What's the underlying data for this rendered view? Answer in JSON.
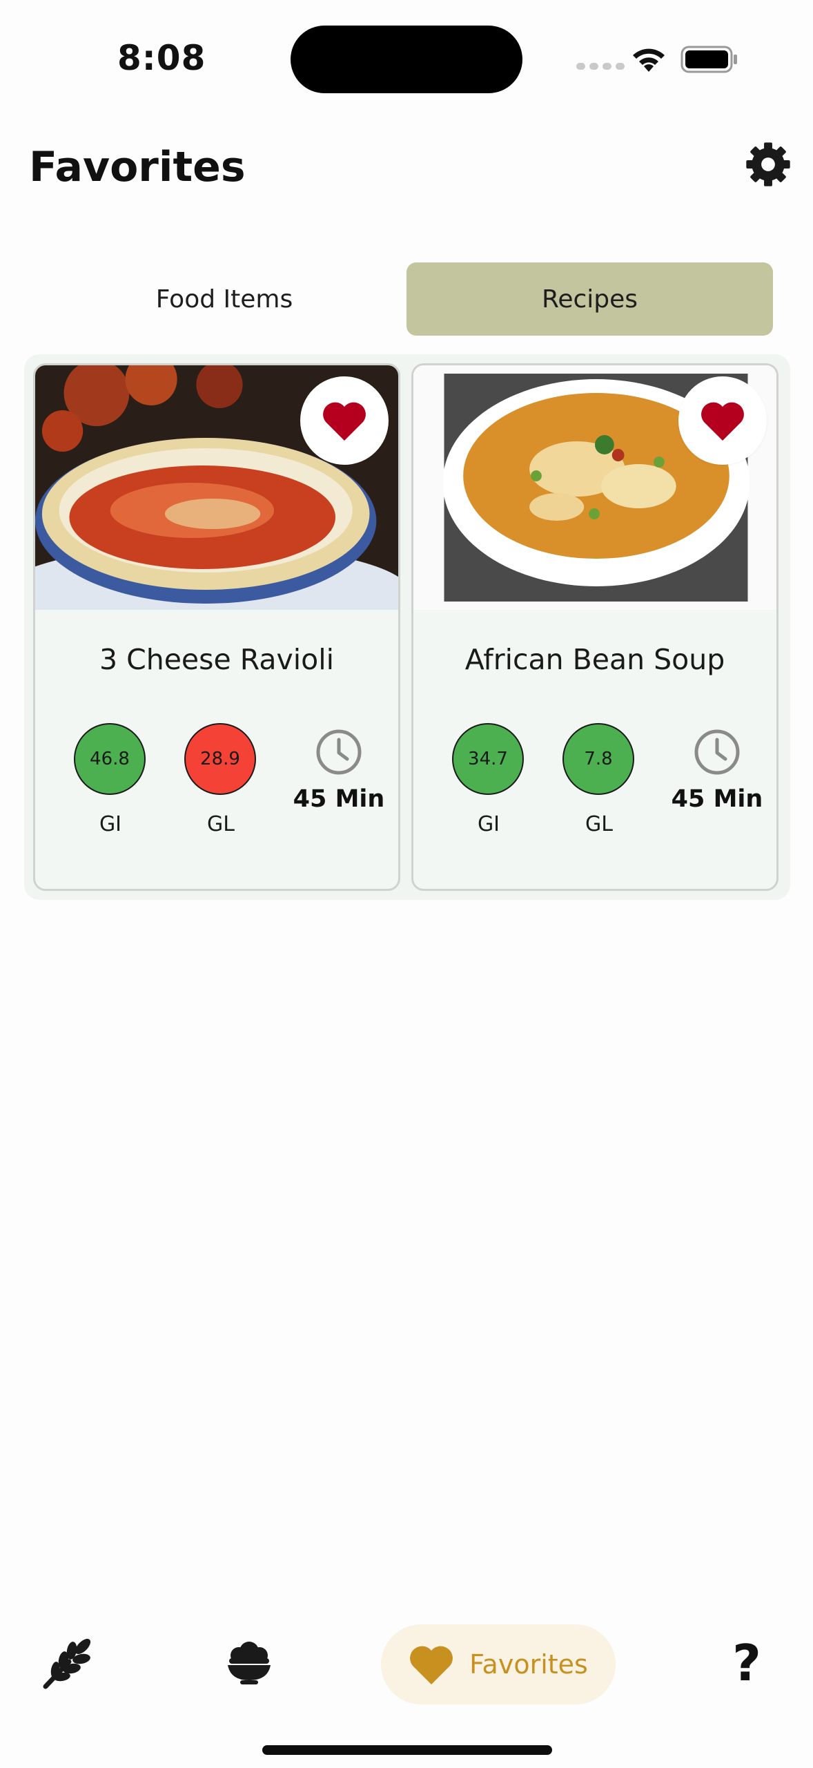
{
  "status_bar": {
    "time": "8:08"
  },
  "header": {
    "title": "Favorites",
    "settings_icon": "gear-icon"
  },
  "tabs": [
    {
      "label": "Food Items",
      "active": false
    },
    {
      "label": "Recipes",
      "active": true
    }
  ],
  "recipes": [
    {
      "name": "3 Cheese Ravioli",
      "gi": "46.8",
      "gi_color": "#4caf50",
      "gl": "28.9",
      "gl_color": "#f44336",
      "gi_label": "GI",
      "gl_label": "GL",
      "time": "45 Min",
      "favorite_icon": "heart-icon"
    },
    {
      "name": "African Bean Soup",
      "gi": "34.7",
      "gi_color": "#4caf50",
      "gl": "7.8",
      "gl_color": "#4caf50",
      "gi_label": "GI",
      "gl_label": "GL",
      "time": "45 Min",
      "favorite_icon": "heart-icon"
    }
  ],
  "bottom_nav": {
    "items": [
      {
        "icon": "wheat-icon"
      },
      {
        "icon": "bowl-icon"
      },
      {
        "icon": "heart-icon",
        "label": "Favorites",
        "active": true
      },
      {
        "icon": "question-icon",
        "label": "?"
      }
    ]
  },
  "colors": {
    "accent": "#c8901f",
    "tab_active": "#c2c59d",
    "heart": "#b4001e"
  }
}
